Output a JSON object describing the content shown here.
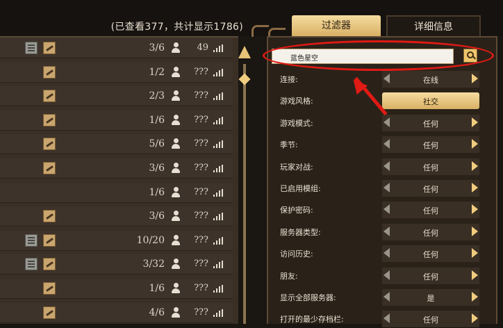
{
  "header": {
    "count_text": "(已查看377，共计显示1786)"
  },
  "server_rows": [
    {
      "icons": [
        "server",
        "wrench"
      ],
      "players": "3/6",
      "ping": "49"
    },
    {
      "icons": [
        "wrench"
      ],
      "players": "1/2",
      "ping": "???"
    },
    {
      "icons": [
        "wrench"
      ],
      "players": "2/3",
      "ping": "???"
    },
    {
      "icons": [
        "wrench"
      ],
      "players": "1/6",
      "ping": "???"
    },
    {
      "icons": [
        "wrench"
      ],
      "players": "5/6",
      "ping": "???"
    },
    {
      "icons": [
        "wrench"
      ],
      "players": "3/6",
      "ping": "???"
    },
    {
      "icons": [],
      "players": "1/6",
      "ping": "???"
    },
    {
      "icons": [
        "wrench"
      ],
      "players": "3/6",
      "ping": "???"
    },
    {
      "icons": [
        "server",
        "wrench"
      ],
      "players": "10/20",
      "ping": "???"
    },
    {
      "icons": [
        "server",
        "wrench"
      ],
      "players": "3/32",
      "ping": "???"
    },
    {
      "icons": [
        "wrench"
      ],
      "players": "1/6",
      "ping": "???"
    },
    {
      "icons": [
        "wrench"
      ],
      "players": "4/6",
      "ping": "???"
    }
  ],
  "tabs": {
    "filter": "过滤器",
    "details": "详细信息"
  },
  "search": {
    "value": "蓝色星空"
  },
  "filters": [
    {
      "label": "连接:",
      "value": "在线",
      "style": "normal"
    },
    {
      "label": "游戏风格:",
      "value": "社交",
      "style": "gold"
    },
    {
      "label": "游戏模式:",
      "value": "任何",
      "style": "normal"
    },
    {
      "label": "季节:",
      "value": "任何",
      "style": "normal"
    },
    {
      "label": "玩家对战:",
      "value": "任何",
      "style": "normal"
    },
    {
      "label": "已启用模组:",
      "value": "任何",
      "style": "normal"
    },
    {
      "label": "保护密码:",
      "value": "任何",
      "style": "normal"
    },
    {
      "label": "服务器类型:",
      "value": "任何",
      "style": "normal"
    },
    {
      "label": "访问历史:",
      "value": "任何",
      "style": "normal"
    },
    {
      "label": "朋友:",
      "value": "任何",
      "style": "normal"
    },
    {
      "label": "显示全部服务器:",
      "value": "是",
      "style": "normal"
    },
    {
      "label": "打开的最少存档栏:",
      "value": "任何",
      "style": "normal"
    }
  ],
  "colors": {
    "accent_gold": "#e8c277",
    "highlight_red": "#e01a14",
    "panel_bg": "#2a2219"
  },
  "icons": {
    "scroll_up": "scroll-up-arrow-icon",
    "search": "magnifier-icon",
    "person": "person-icon",
    "signal": "signal-bars-icon"
  }
}
